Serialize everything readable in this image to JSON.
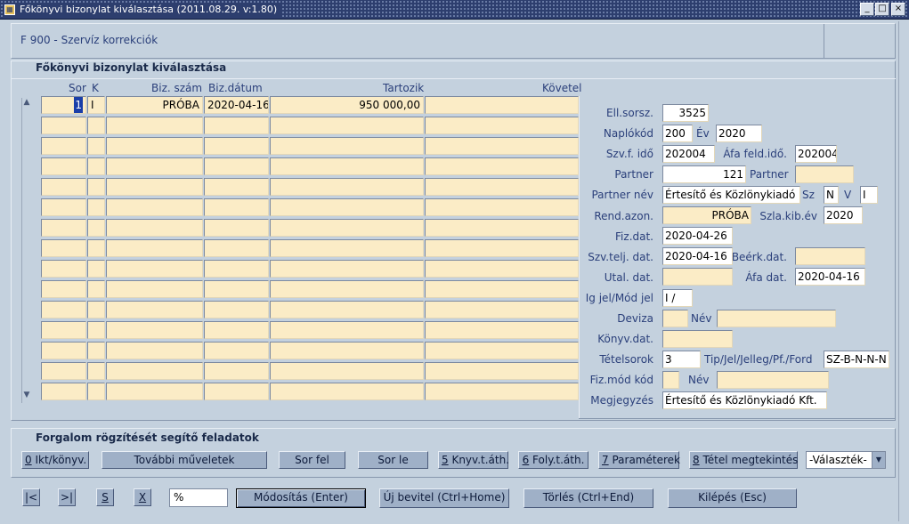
{
  "window": {
    "title": "Főkönyvi bizonylat kiválasztása (2011.08.29. v:1.80)",
    "minimize": "_",
    "maximize": "□",
    "close": "×"
  },
  "header": {
    "module": "F 900 - Szervíz korrekciók"
  },
  "section": {
    "title": "Főkönyvi bizonylat kiválasztása"
  },
  "grid": {
    "columns": {
      "sor": "Sor",
      "k": "K",
      "biz_szam": "Biz. szám",
      "biz_datum": "Biz.dátum",
      "tartozik": "Tartozik",
      "kovetel": "Követel"
    },
    "row1": {
      "sor": "1",
      "k": "I",
      "biz_szam": "PRÓBA",
      "biz_datum": "2020-04-16",
      "tartozik": "950 000,00",
      "kovetel": ""
    },
    "scroll_up": "▲",
    "scroll_down": "▼"
  },
  "detail": {
    "ell_sorsz": {
      "label": "Ell.sorsz.",
      "value": "3525"
    },
    "naplokod": {
      "label": "Naplókód",
      "value": "200"
    },
    "ev": {
      "label": "Év",
      "value": "2020"
    },
    "szvf_ido": {
      "label": "Szv.f. idő",
      "value": "202004"
    },
    "afa_feld_ido": {
      "label": "Áfa feld.idő.",
      "value": "202004"
    },
    "partner": {
      "label": "Partner",
      "value": "121"
    },
    "partner2": {
      "label": "Partner",
      "value": ""
    },
    "partner_nev": {
      "label": "Partner név",
      "value": "Értesítő és Közlönykiadó Kft."
    },
    "sz": {
      "label": "Sz",
      "value": "N"
    },
    "v": {
      "label": "V",
      "value": "I"
    },
    "rend_azon": {
      "label": "Rend.azon.",
      "value": "PRÓBA"
    },
    "szla_kib_ev": {
      "label": "Szla.kib.év",
      "value": "2020"
    },
    "fiz_dat": {
      "label": "Fiz.dat.",
      "value": "2020-04-26"
    },
    "szv_telj_dat": {
      "label": "Szv.telj. dat.",
      "value": "2020-04-16"
    },
    "beerk_dat": {
      "label": "Beérk.dat.",
      "value": ""
    },
    "utal_dat": {
      "label": "Utal. dat.",
      "value": ""
    },
    "afa_dat": {
      "label": "Áfa dat.",
      "value": "2020-04-16"
    },
    "ig_jel": {
      "label": "Ig jel/Mód jel",
      "value": "I /"
    },
    "deviza": {
      "label": "Deviza",
      "value": ""
    },
    "nev1": {
      "label": "Név",
      "value": ""
    },
    "konyv_dat": {
      "label": "Könyv.dat.",
      "value": ""
    },
    "tetelsorok": {
      "label": "Tételsorok",
      "value": "3"
    },
    "tip_jel": {
      "label": "Tip/Jel/Jelleg/Pf./Ford",
      "value": "SZ-B-N-N-N"
    },
    "fiz_mod_kod": {
      "label": "Fiz.mód kód",
      "value": ""
    },
    "nev2": {
      "label": "Név",
      "value": ""
    },
    "megjegyzes": {
      "label": "Megjegyzés",
      "value": "Értesítő és Közlönykiadó Kft."
    }
  },
  "tasks": {
    "title": "Forgalom rögzítését segítő feladatok",
    "b0_key": "0",
    "b0_rest": " Ikt/könyv.",
    "b_tovabbi": "További műveletek",
    "b_sorfel": "Sor fel",
    "b_sorle": "Sor le",
    "b5_key": "5",
    "b5_rest": " Knyv.t.áth.",
    "b6_key": "6",
    "b6_rest": " Foly.t.áth.",
    "b7_key": "7",
    "b7_rest": " Paraméterek",
    "b8_key": "8",
    "b8_rest": " Tétel megtekintés",
    "select_value": "-Választék-",
    "select_arrow": "▼"
  },
  "bottom": {
    "first": "|<",
    "last": ">|",
    "s": "S",
    "x": "X",
    "search": "%",
    "modositas": "Módosítás (Enter)",
    "uj_bevitel": "Új bevitel (Ctrl+Home)",
    "torles": "Törlés (Ctrl+End)",
    "kilepes": "Kilépés (Esc)"
  }
}
